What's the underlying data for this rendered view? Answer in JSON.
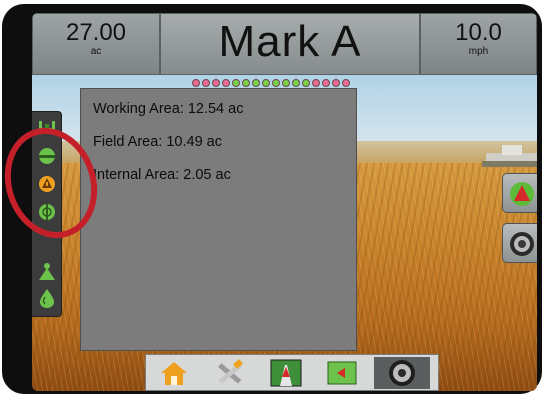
{
  "header": {
    "left_value": "27.00",
    "left_unit": "ac",
    "title": "Mark A",
    "right_value": "10.0",
    "right_unit": "mph"
  },
  "boom_sections": [
    "pink",
    "pink",
    "pink",
    "pink",
    "green",
    "green",
    "green",
    "green",
    "green",
    "green",
    "green",
    "green",
    "pink",
    "pink",
    "pink",
    "pink"
  ],
  "info_popup": {
    "working_area": "Working Area: 12.54 ac",
    "field_area": "Field Area: 10.49 ac",
    "internal_area": "Internal Area: 2.05 ac"
  },
  "left_toolbar": {
    "icons": [
      "boom-icon",
      "marker-line-icon",
      "warning-icon",
      "globe-icon",
      "spray-cone-icon",
      "drop-icon"
    ]
  },
  "right_toolbar": {
    "icons": [
      "guidance-arrow-icon",
      "camera-lens-icon"
    ]
  },
  "bottom_nav": {
    "icons": [
      "home-icon",
      "tools-icon",
      "guidance-view-icon",
      "field-map-icon",
      "camera-icon"
    ],
    "active": "camera-icon"
  },
  "colors": {
    "panel": "#8f9596",
    "popup": "#7c7c7c",
    "annotation": "#c5202a",
    "section_on": "#7bd24a",
    "section_off": "#e86b96"
  }
}
